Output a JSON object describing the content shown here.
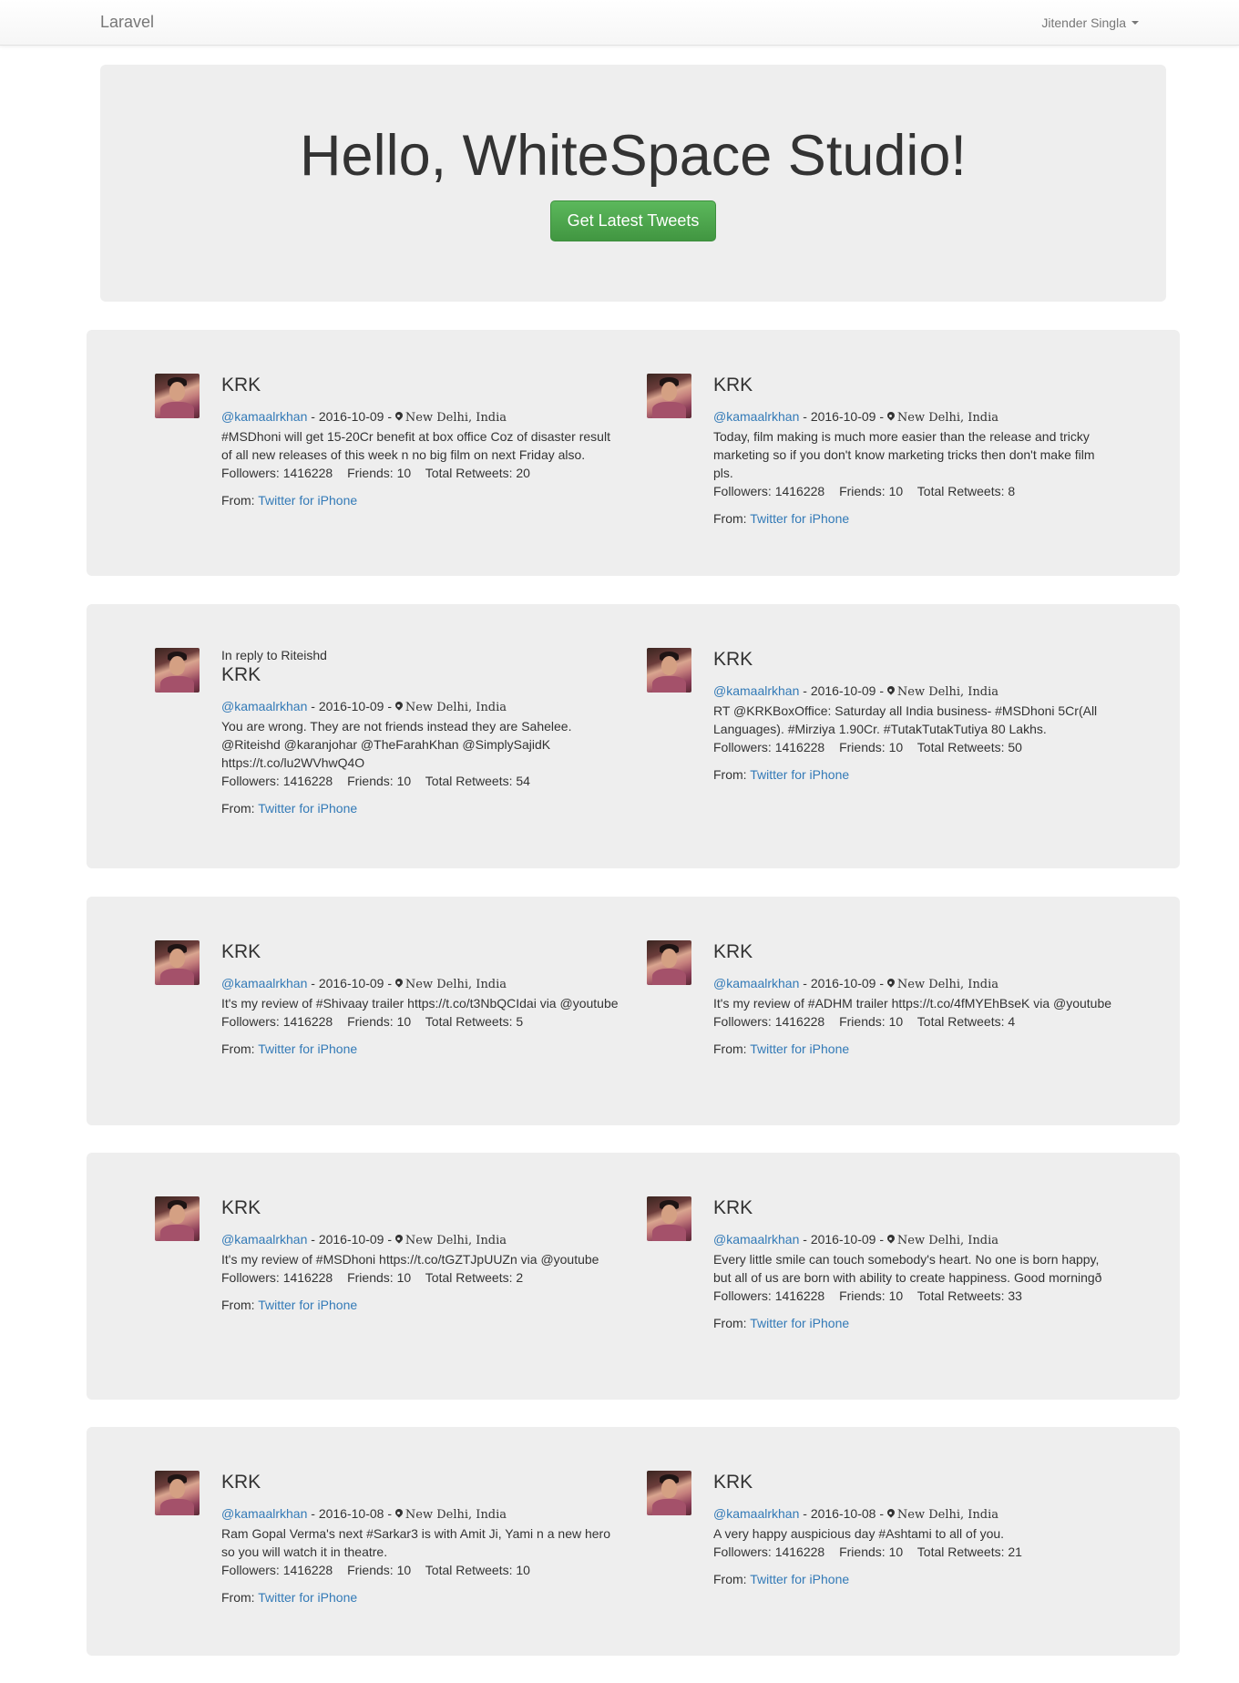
{
  "navbar": {
    "brand": "Laravel",
    "user": "Jitender Singla"
  },
  "jumbotron": {
    "heading": "Hello, WhiteSpace Studio!",
    "button_label": "Get Latest Tweets"
  },
  "labels": {
    "followers": "Followers:",
    "friends": "Friends:",
    "retweets": "Total Retweets:",
    "from": "From:",
    "separator": " - "
  },
  "tweets": [
    {
      "reply_to": "",
      "name": "KRK",
      "handle": "@kamaalrkhan",
      "date": "2016-10-09",
      "location": "New Delhi, India",
      "text": "#MSDhoni will get 15-20Cr benefit at box office Coz of disaster result of all new releases of this week n no big film on next Friday also.",
      "followers": "1416228",
      "friends": "10",
      "retweets": "20",
      "source": "Twitter for iPhone"
    },
    {
      "reply_to": "",
      "name": "KRK",
      "handle": "@kamaalrkhan",
      "date": "2016-10-09",
      "location": "New Delhi, India",
      "text": "Today, film making is much more easier than the release and tricky marketing so if you don't know marketing tricks then don't make film pls.",
      "followers": "1416228",
      "friends": "10",
      "retweets": "8",
      "source": "Twitter for iPhone"
    },
    {
      "reply_to": "In reply to Riteishd",
      "name": "KRK",
      "handle": "@kamaalrkhan",
      "date": "2016-10-09",
      "location": "New Delhi, India",
      "text": "You are wrong. They are not friends instead they are Sahelee. @Riteishd @karanjohar @TheFarahKhan @SimplySajidK https://t.co/lu2WVhwQ4O",
      "followers": "1416228",
      "friends": "10",
      "retweets": "54",
      "source": "Twitter for iPhone"
    },
    {
      "reply_to": "",
      "name": "KRK",
      "handle": "@kamaalrkhan",
      "date": "2016-10-09",
      "location": "New Delhi, India",
      "text": "RT @KRKBoxOffice: Saturday all India business- #MSDhoni 5Cr(All Languages). #Mirziya 1.90Cr. #TutakTutakTutiya 80 Lakhs.",
      "followers": "1416228",
      "friends": "10",
      "retweets": "50",
      "source": "Twitter for iPhone"
    },
    {
      "reply_to": "",
      "name": "KRK",
      "handle": "@kamaalrkhan",
      "date": "2016-10-09",
      "location": "New Delhi, India",
      "text": "It's my review of #Shivaay trailer https://t.co/t3NbQCIdai via @youtube",
      "followers": "1416228",
      "friends": "10",
      "retweets": "5",
      "source": "Twitter for iPhone"
    },
    {
      "reply_to": "",
      "name": "KRK",
      "handle": "@kamaalrkhan",
      "date": "2016-10-09",
      "location": "New Delhi, India",
      "text": "It's my review of #ADHM trailer https://t.co/4fMYEhBseK via @youtube",
      "followers": "1416228",
      "friends": "10",
      "retweets": "4",
      "source": "Twitter for iPhone"
    },
    {
      "reply_to": "",
      "name": "KRK",
      "handle": "@kamaalrkhan",
      "date": "2016-10-09",
      "location": "New Delhi, India",
      "text": "It's my review of #MSDhoni https://t.co/tGZTJpUUZn via @youtube",
      "followers": "1416228",
      "friends": "10",
      "retweets": "2",
      "source": "Twitter for iPhone"
    },
    {
      "reply_to": "",
      "name": "KRK",
      "handle": "@kamaalrkhan",
      "date": "2016-10-09",
      "location": "New Delhi, India",
      "text": "Every little smile can touch somebody's heart. No one is born happy, but all of us are born with ability to create happiness. Good morningð",
      "followers": "1416228",
      "friends": "10",
      "retweets": "33",
      "source": "Twitter for iPhone"
    },
    {
      "reply_to": "",
      "name": "KRK",
      "handle": "@kamaalrkhan",
      "date": "2016-10-08",
      "location": "New Delhi, India",
      "text": "Ram Gopal Verma's next #Sarkar3 is with Amit Ji, Yami n a new hero so you will watch it in theatre.",
      "followers": "1416228",
      "friends": "10",
      "retweets": "10",
      "source": "Twitter for iPhone"
    },
    {
      "reply_to": "",
      "name": "KRK",
      "handle": "@kamaalrkhan",
      "date": "2016-10-08",
      "location": "New Delhi, India",
      "text": "A very happy auspicious day #Ashtami to all of you.",
      "followers": "1416228",
      "friends": "10",
      "retweets": "21",
      "source": "Twitter for iPhone"
    }
  ]
}
